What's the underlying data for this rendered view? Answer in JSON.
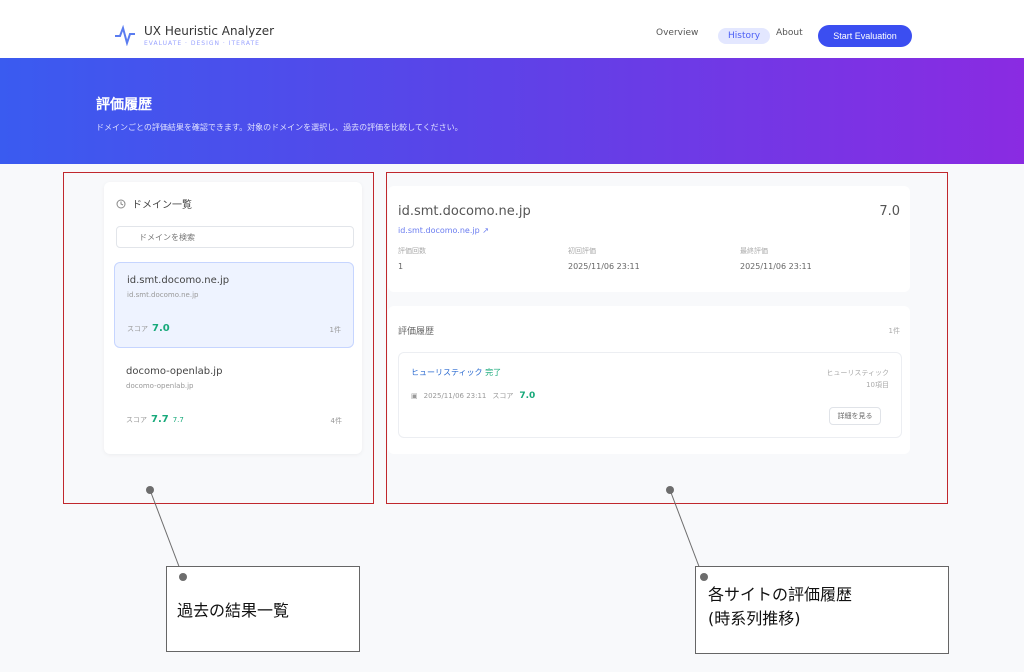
{
  "nav": {
    "brand_title": "UX Heuristic Analyzer",
    "brand_tagline": "EVALUATE · DESIGN · ITERATE",
    "links": [
      "Overview",
      "History",
      "About"
    ],
    "cta_label": "Start Evaluation"
  },
  "hero": {
    "title": "評価履歴",
    "subtitle": "ドメインごとの評価結果を確認できます。対象のドメインを選択し、過去の評価を比較してください。"
  },
  "domains_panel": {
    "header": "ドメイン一覧",
    "search_placeholder": "ドメインを検索",
    "items": [
      {
        "title": "id.smt.docomo.ne.jp",
        "url": "id.smt.docomo.ne.jp",
        "score_label": "スコア",
        "score": "7.0",
        "count": "1件"
      },
      {
        "title": "docomo-openlab.jp",
        "url": "docomo-openlab.jp",
        "score_label": "スコア",
        "score": "7.7",
        "extra": "7.7",
        "count": "4件"
      }
    ]
  },
  "domain_detail": {
    "title": "id.smt.docomo.ne.jp",
    "score": "7.0",
    "link": "id.smt.docomo.ne.jp",
    "stats": [
      {
        "label": "評価回数",
        "value": "1"
      },
      {
        "label": "初回評価",
        "value": "2025/11/06 23:11"
      },
      {
        "label": "最終評価",
        "value": "2025/11/06 23:11"
      }
    ]
  },
  "history": {
    "title": "評価履歴",
    "count": "1件",
    "entries": [
      {
        "badge": "ヒューリスティック",
        "badge_tag": "完了",
        "date": "2025/11/06 23:11",
        "score_label": "スコア",
        "score": "7.0",
        "side_top": "ヒューリスティック",
        "side_bottom": "10項目",
        "button": "詳細を見る"
      }
    ]
  },
  "annotations": {
    "left": "過去の結果一覧",
    "right_line1": "各サイトの評価履歴",
    "right_line2": "(時系列推移)"
  },
  "colors": {
    "accent": "#3b4ef1",
    "gradient_start": "#3a5bf0",
    "gradient_end": "#8a2be2",
    "score_green": "#17a97a",
    "highlight_red": "#c0282d"
  }
}
